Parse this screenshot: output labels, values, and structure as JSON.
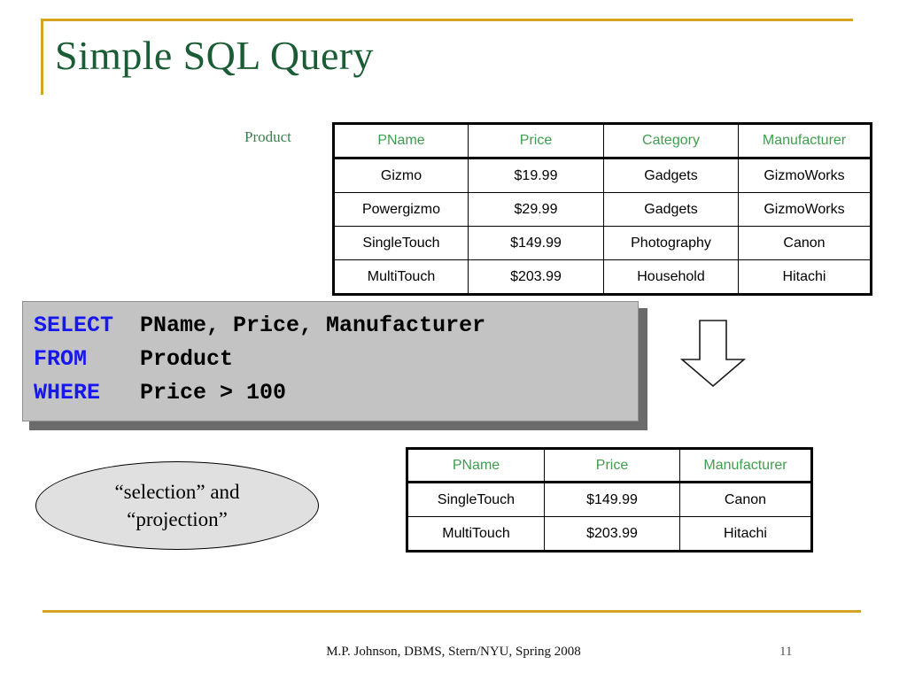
{
  "slide": {
    "title": "Simple SQL Query",
    "accent_color": "#d4a422",
    "title_color": "#1a5c33"
  },
  "relation_label": "Product",
  "product_table": {
    "headers": [
      "PName",
      "Price",
      "Category",
      "Manufacturer"
    ],
    "rows": [
      [
        "Gizmo",
        "$19.99",
        "Gadgets",
        "GizmoWorks"
      ],
      [
        "Powergizmo",
        "$29.99",
        "Gadgets",
        "GizmoWorks"
      ],
      [
        "SingleTouch",
        "$149.99",
        "Photography",
        "Canon"
      ],
      [
        "MultiTouch",
        "$203.99",
        "Household",
        "Hitachi"
      ]
    ],
    "header_color": "#3f9e4d"
  },
  "sql": {
    "keyword_color": "#1717ef",
    "background": "#c3c3c3",
    "lines": [
      {
        "keyword": "SELECT",
        "body": "PName, Price, Manufacturer"
      },
      {
        "keyword": "FROM",
        "body": "Product"
      },
      {
        "keyword": "WHERE",
        "body": "Price > 100"
      }
    ]
  },
  "arrow": {
    "direction": "down",
    "icon": "down-block-arrow-icon"
  },
  "callout": {
    "line1": "“selection” and",
    "line2": "“projection”",
    "fill": "#e0e0e0"
  },
  "result_table": {
    "headers": [
      "PName",
      "Price",
      "Manufacturer"
    ],
    "rows": [
      [
        "SingleTouch",
        "$149.99",
        "Canon"
      ],
      [
        "MultiTouch",
        "$203.99",
        "Hitachi"
      ]
    ],
    "header_color": "#3f9e4d"
  },
  "footer": {
    "text": "M.P. Johnson, DBMS, Stern/NYU, Spring 2008",
    "page_number": "11"
  }
}
